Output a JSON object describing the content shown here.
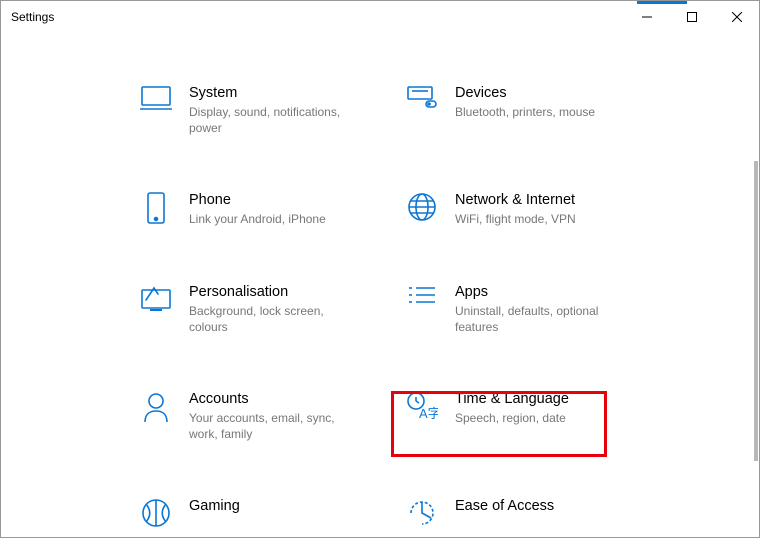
{
  "window": {
    "title": "Settings"
  },
  "items": [
    {
      "title": "System",
      "desc": "Display, sound, notifications, power"
    },
    {
      "title": "Devices",
      "desc": "Bluetooth, printers, mouse"
    },
    {
      "title": "Phone",
      "desc": "Link your Android, iPhone"
    },
    {
      "title": "Network & Internet",
      "desc": "WiFi, flight mode, VPN"
    },
    {
      "title": "Personalisation",
      "desc": "Background, lock screen, colours"
    },
    {
      "title": "Apps",
      "desc": "Uninstall, defaults, optional features"
    },
    {
      "title": "Accounts",
      "desc": "Your accounts, email, sync, work, family"
    },
    {
      "title": "Time & Language",
      "desc": "Speech, region, date"
    },
    {
      "title": "Gaming",
      "desc": ""
    },
    {
      "title": "Ease of Access",
      "desc": ""
    }
  ]
}
